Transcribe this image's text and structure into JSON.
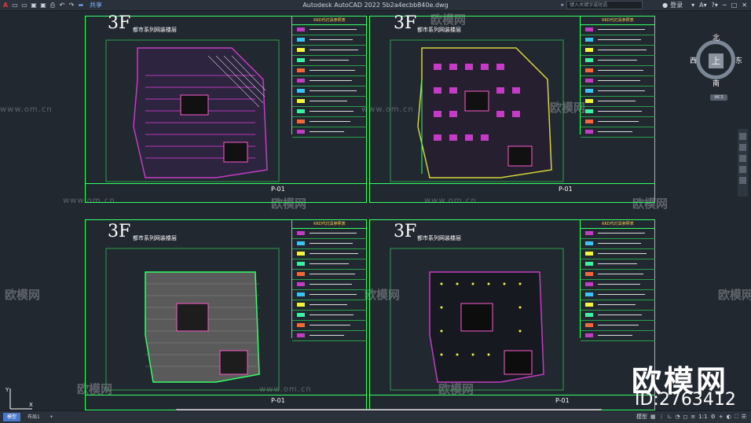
{
  "app": {
    "title": "Autodesk AutoCAD 2022    5b2a4ecbb840e.dwg",
    "share_label": "共享",
    "search_placeholder": "键入关键字或短语",
    "login_label": "登录"
  },
  "quick_access": [
    "open-icon",
    "new-icon",
    "save-icon",
    "saveas-icon",
    "print-icon",
    "undo-icon",
    "redo-icon"
  ],
  "sheets": [
    {
      "floor": "3F",
      "subtitle": "都市系列网装楼层",
      "page": "P-01",
      "plan_color": "#c43cc4"
    },
    {
      "floor": "3F",
      "subtitle": "都市系列网装楼层",
      "page": "P-01",
      "plan_color": "#d4d438"
    },
    {
      "floor": "3F",
      "subtitle": "都市系列网装楼层",
      "page": "P-01",
      "plan_color": "#9a9a9a"
    },
    {
      "floor": "3F",
      "subtitle": "都市系列网装楼层",
      "page": "P-01",
      "plan_color": "#c43cc4"
    }
  ],
  "legend_header": "KKD代灯具参照表",
  "watermarks": {
    "brand_text": "欧模网",
    "site_text": "www.om.cn"
  },
  "brand": {
    "name": "欧模网",
    "id": "ID:2763412"
  },
  "viewcube": {
    "north": "北",
    "south": "南",
    "east": "东",
    "west": "西",
    "top": "上",
    "wcs": "WCS"
  },
  "statusbar": {
    "tabs": [
      "模型",
      "布局1"
    ],
    "add_tab": "+",
    "model_label": "模型",
    "scale": "1:1"
  },
  "accent": "#4a78c8"
}
